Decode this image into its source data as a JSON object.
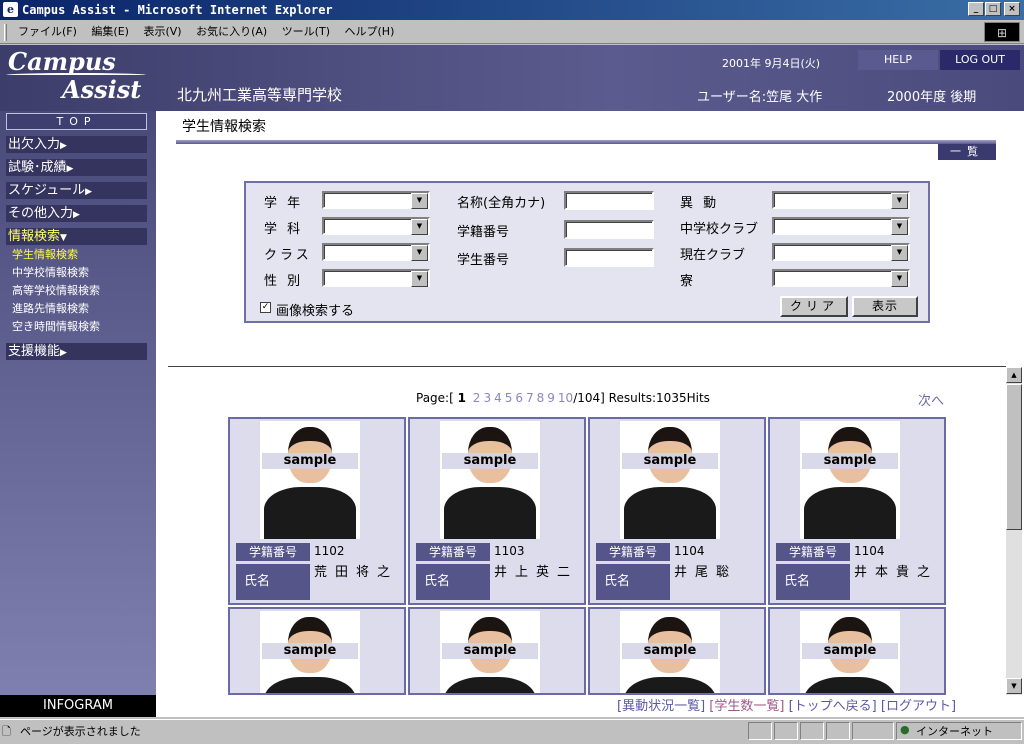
{
  "window": {
    "title": "Campus Assist - Microsoft Internet Explorer",
    "ie_icon": "e",
    "min": "_",
    "max": "□",
    "close": "×"
  },
  "menubar": {
    "items": [
      "ファイル(F)",
      "編集(E)",
      "表示(V)",
      "お気に入り(A)",
      "ツール(T)",
      "ヘルプ(H)"
    ]
  },
  "header": {
    "logo_line1": "Campus",
    "logo_line2": "Assist",
    "school": "北九州工業高等専門学校",
    "date": "2001年 9月4日(火)",
    "help": "HELP",
    "logout": "LOG OUT",
    "user": "ユーザー名:笠尾 大作",
    "term": "2000年度 後期"
  },
  "sidebar": {
    "top": "TOP",
    "items": [
      "出欠入力",
      "試験･成績",
      "スケジュール",
      "その他入力",
      "情報検索",
      "支援機能"
    ],
    "subitems": [
      "学生情報検索",
      "中学校情報検索",
      "高等学校情報検索",
      "進路先情報検索",
      "空き時間情報検索"
    ],
    "infogram": "INFOGRAM"
  },
  "page": {
    "title": "学生情報検索",
    "list_button": "一覧"
  },
  "search": {
    "labels_col1": [
      "学 年",
      "学 科",
      "クラス",
      "性 別"
    ],
    "labels_col2": [
      "名称(全角カナ)",
      "学籍番号",
      "学生番号"
    ],
    "labels_col3": [
      "異 動",
      "中学校クラブ",
      "現在クラブ",
      "寮"
    ],
    "image_search": "画像検索する",
    "checkbox_mark": "✓",
    "clear": "クリア",
    "show": "表示"
  },
  "pager": {
    "prefix": "Page:[",
    "current": "1",
    "pages": [
      "2",
      "3",
      "4",
      "5",
      "6",
      "7",
      "8",
      "9",
      "10"
    ],
    "suffix": "/104]",
    "results": "Results:1035Hits",
    "next": "次へ"
  },
  "cards": [
    {
      "id_label": "学籍番号",
      "id": "1102",
      "name_label": "氏名",
      "name": "荒田将之",
      "stamp": "sample"
    },
    {
      "id_label": "学籍番号",
      "id": "1103",
      "name_label": "氏名",
      "name": "井上英二",
      "stamp": "sample"
    },
    {
      "id_label": "学籍番号",
      "id": "1104",
      "name_label": "氏名",
      "name": "井尾聡",
      "stamp": "sample"
    },
    {
      "id_label": "学籍番号",
      "id": "1104",
      "name_label": "氏名",
      "name": "井本貴之",
      "stamp": "sample"
    },
    {
      "stamp": "sample"
    },
    {
      "stamp": "sample"
    },
    {
      "stamp": "sample"
    },
    {
      "stamp": "sample"
    }
  ],
  "footer": {
    "links": [
      "[異動状況一覧]",
      "[学生数一覧]",
      "[トップへ戻る]",
      "[ログアウト]"
    ]
  },
  "statusbar": {
    "status": "ページが表示されました",
    "zone": "インターネット"
  }
}
